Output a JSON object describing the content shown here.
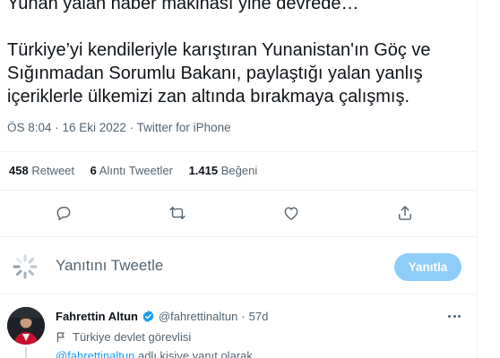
{
  "tweet": {
    "text": "Yunan yalan haber makinası yine devrede…\n\nTürkiye’yi kendileriyle karıştıran Yunanistan'ın Göç ve Sığınmadan Sorumlu Bakanı, paylaştığı yalan yanlış içeriklerle ülkemizi zan altında bırakmaya çalışmış.",
    "timestamp": "ÖS 8:04 · 16 Eki 2022 · Twitter for iPhone"
  },
  "stats": {
    "retweets_count": "458",
    "retweets_label": "Retweet",
    "quotes_count": "6",
    "quotes_label": "Alıntı Tweetler",
    "likes_count": "1.415",
    "likes_label": "Beğeni"
  },
  "actions": {
    "icons": [
      "reply-icon",
      "retweet-icon",
      "like-icon",
      "share-icon"
    ]
  },
  "composer": {
    "placeholder": "Yanıtını Tweetle",
    "reply_button": "Yanıtla"
  },
  "reply": {
    "name": "Fahrettin Altun",
    "handle": "@fahrettinaltun",
    "separator": "·",
    "time": "57d",
    "label": "Türkiye devlet görevlisi",
    "replying_mention": "@fahrettinaltun",
    "replying_text": " adlı kişiye yanıt olarak"
  },
  "colors": {
    "accent": "#1d9bf0",
    "reply_button_disabled": "#8ecdf8",
    "secondary_text": "#536471",
    "divider": "#eff3f4"
  }
}
